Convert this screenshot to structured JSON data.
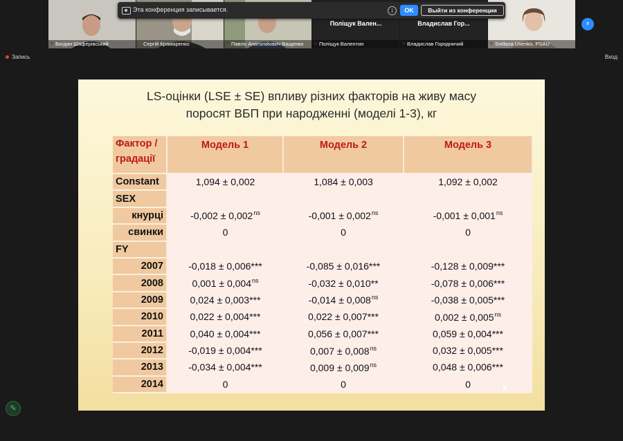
{
  "participants": [
    {
      "name": "Богдан Шаферівський",
      "muted": true,
      "active": false
    },
    {
      "name": "Сергій Крамаренко",
      "muted": false,
      "active": false
    },
    {
      "name": "Павло Анатолійович Ващенко",
      "muted": true,
      "active": true
    },
    {
      "name": "Поліщук Валентин",
      "muted": true,
      "active": false,
      "center_name": "Поліщук Вален..."
    },
    {
      "name": "Владислав Городничий",
      "muted": true,
      "active": false,
      "center_name": "Владислав Гор..."
    },
    {
      "name": "Svitlana Usenko, PSAU",
      "muted": true,
      "active": false
    }
  ],
  "recording_banner": {
    "text": "Эта конференция записывается.",
    "ok_label": "OK",
    "leave_label": "Выйти из конференции"
  },
  "recording_indicator": "Запись",
  "exit_label": "Вход",
  "slide": {
    "title_line1": "LS-оцінки (LSE ± SE) впливу різних факторів на живу масу",
    "title_line2": "поросят ВБП при народженні (моделі 1-3), кг",
    "header": {
      "factor": "Фактор / градації",
      "models": [
        "Модель 1",
        "Модель 2",
        "Модель 3"
      ]
    },
    "rows": [
      {
        "label": "Constant",
        "align": "left",
        "cells": [
          {
            "v": "1,094 ± 0,002",
            "s": ""
          },
          {
            "v": "1,084 ± 0,003",
            "s": ""
          },
          {
            "v": "1,092 ± 0,002",
            "s": ""
          }
        ]
      },
      {
        "label": "SEX",
        "align": "left",
        "group": true,
        "cells": []
      },
      {
        "label": "кнурці",
        "align": "right",
        "cells": [
          {
            "v": "-0,002 ± 0,002",
            "s": "ns"
          },
          {
            "v": "-0,001 ± 0,002",
            "s": "ns"
          },
          {
            "v": "-0,001 ± 0,001",
            "s": "ns"
          }
        ]
      },
      {
        "label": "свинки",
        "align": "right",
        "cells": [
          {
            "v": "0",
            "s": ""
          },
          {
            "v": "0",
            "s": ""
          },
          {
            "v": "0",
            "s": ""
          }
        ]
      },
      {
        "label": "FY",
        "align": "left",
        "group": true,
        "cells": []
      },
      {
        "label": "2007",
        "align": "right",
        "cells": [
          {
            "v": "-0,018 ± 0,006***",
            "s": ""
          },
          {
            "v": "-0,085 ± 0,016***",
            "s": ""
          },
          {
            "v": "-0,128 ± 0,009***",
            "s": ""
          }
        ]
      },
      {
        "label": "2008",
        "align": "right",
        "cells": [
          {
            "v": "0,001 ± 0,004",
            "s": "ns"
          },
          {
            "v": "-0,032 ± 0,010**",
            "s": ""
          },
          {
            "v": "-0,078 ± 0,006***",
            "s": ""
          }
        ]
      },
      {
        "label": "2009",
        "align": "right",
        "cells": [
          {
            "v": "0,024 ± 0,003***",
            "s": ""
          },
          {
            "v": "-0,014 ± 0,008",
            "s": "ns"
          },
          {
            "v": "-0,038 ± 0,005***",
            "s": ""
          }
        ]
      },
      {
        "label": "2010",
        "align": "right",
        "cells": [
          {
            "v": "0,022 ± 0,004***",
            "s": ""
          },
          {
            "v": "0,022 ± 0,007***",
            "s": ""
          },
          {
            "v": "0,002 ± 0,005",
            "s": "ns"
          }
        ]
      },
      {
        "label": "2011",
        "align": "right",
        "cells": [
          {
            "v": "0,040 ± 0,004***",
            "s": ""
          },
          {
            "v": "0,056 ± 0,007***",
            "s": ""
          },
          {
            "v": "0,059 ± 0,004***",
            "s": ""
          }
        ]
      },
      {
        "label": "2012",
        "align": "right",
        "cells": [
          {
            "v": "-0,019 ± 0,004***",
            "s": ""
          },
          {
            "v": "0,007 ± 0,008",
            "s": "ns"
          },
          {
            "v": "0,032 ± 0,005***",
            "s": ""
          }
        ]
      },
      {
        "label": "2013",
        "align": "right",
        "cells": [
          {
            "v": "-0,034 ± 0,004***",
            "s": ""
          },
          {
            "v": "0,009 ± 0,009",
            "s": "ns"
          },
          {
            "v": "0,048 ± 0,006***",
            "s": ""
          }
        ]
      },
      {
        "label": "2014",
        "align": "right",
        "cells": [
          {
            "v": "0",
            "s": ""
          },
          {
            "v": "0",
            "s": ""
          },
          {
            "v": "0",
            "s": ""
          }
        ]
      }
    ]
  },
  "colors": {
    "accent_blue": "#2d8cff",
    "header_red": "#c01818",
    "active_speaker": "#7fd14a",
    "muted_red": "#e0443e"
  }
}
